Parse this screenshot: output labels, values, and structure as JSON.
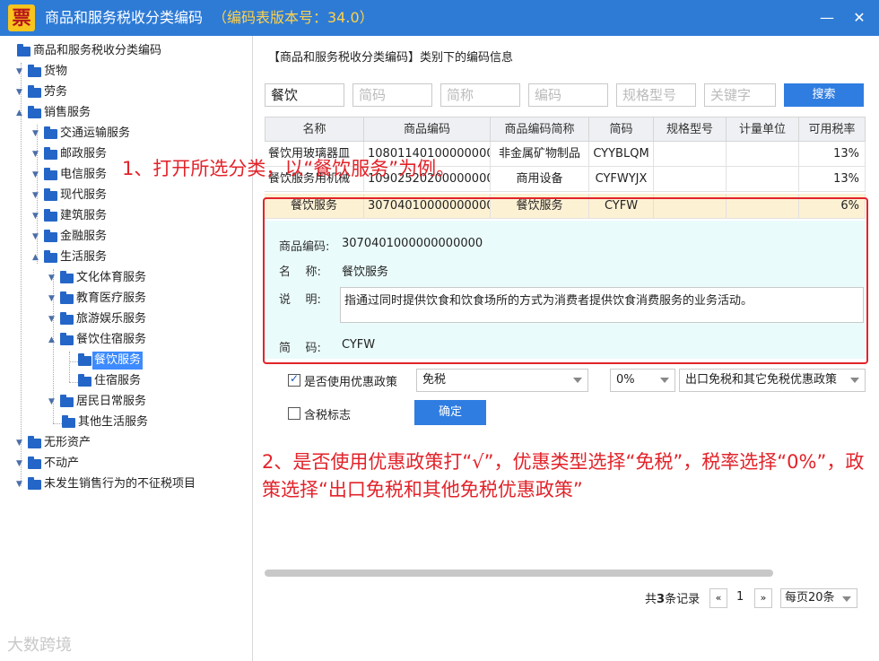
{
  "window": {
    "logo_text": "票",
    "title": "商品和服务税收分类编码",
    "version": "（编码表版本号：34.0）",
    "minimize": "—",
    "close": "✕"
  },
  "tree": {
    "root": "商品和服务税收分类编码",
    "n1": "货物",
    "n2": "劳务",
    "n3": "销售服务",
    "n3_1": "交通运输服务",
    "n3_2": "邮政服务",
    "n3_3": "电信服务",
    "n3_4": "现代服务",
    "n3_5": "建筑服务",
    "n3_6": "金融服务",
    "n3_7": "生活服务",
    "n3_7_1": "文化体育服务",
    "n3_7_2": "教育医疗服务",
    "n3_7_3": "旅游娱乐服务",
    "n3_7_4": "餐饮住宿服务",
    "n3_7_4_1": "餐饮服务",
    "n3_7_4_2": "住宿服务",
    "n3_7_5": "居民日常服务",
    "n3_7_6": "其他生活服务",
    "n4": "无形资产",
    "n5": "不动产",
    "n6": "未发生销售行为的不征税项目"
  },
  "panel": {
    "header": "【商品和服务税收分类编码】类别下的编码信息"
  },
  "search": {
    "name_value": "餐饮",
    "short_code_placeholder": "简码",
    "short_name_placeholder": "简称",
    "code_placeholder": "编码",
    "spec_placeholder": "规格型号",
    "keyword_placeholder": "关键字",
    "search_label": "搜索"
  },
  "table": {
    "headers": [
      "名称",
      "商品编码",
      "商品编码简称",
      "简码",
      "规格型号",
      "计量单位",
      "可用税率"
    ],
    "rows": [
      [
        "餐饮用玻璃器皿",
        "108011401000000000",
        "非金属矿物制品",
        "CYYBLQM",
        "",
        "",
        "13%"
      ],
      [
        "餐饮服务用机械",
        "109025202000000000",
        "商用设备",
        "CYFWYJX",
        "",
        "",
        "13%"
      ],
      [
        "餐饮服务",
        "307040100000000000",
        "餐饮服务",
        "CYFW",
        "",
        "",
        "6%"
      ]
    ]
  },
  "detail": {
    "code_label": "商品编码:",
    "code_value": "3070401000000000000",
    "name_label": "名    称:",
    "name_value": "餐饮服务",
    "desc_label": "说    明:",
    "desc_value": "指通过同时提供饮食和饮食场所的方式为消费者提供饮食消费服务的业务活动。",
    "short_label": "简    码:",
    "short_value": "CYFW"
  },
  "policy": {
    "use_label": "是否使用优惠政策",
    "use_checked": true,
    "type_value": "免税",
    "rate_value": "0%",
    "policy_value": "出口免税和其它免税优惠政策",
    "tax_included_label": "含税标志",
    "tax_included_checked": false,
    "confirm_label": "确定"
  },
  "annotations": {
    "step1": "1、打开所选分类，以“餐饮服务”为例。",
    "step2": "2、是否使用优惠政策打“√”，优惠类型选择“免税”，税率选择“0%”，政策选择“出口免税和其他免税优惠政策”"
  },
  "pager": {
    "total_prefix": "共",
    "total_count": "3",
    "total_suffix": "条记录",
    "prev": "«",
    "page": "1",
    "next": "»",
    "page_size": "每页20条"
  },
  "watermark": "大数跨境",
  "colors": {
    "titlebar": "#2e7bd6",
    "accent": "#2f7de1",
    "annotation_red": "#e2232a",
    "detail_bg": "#eafbfb",
    "selected_row": "#fdf1d3"
  }
}
